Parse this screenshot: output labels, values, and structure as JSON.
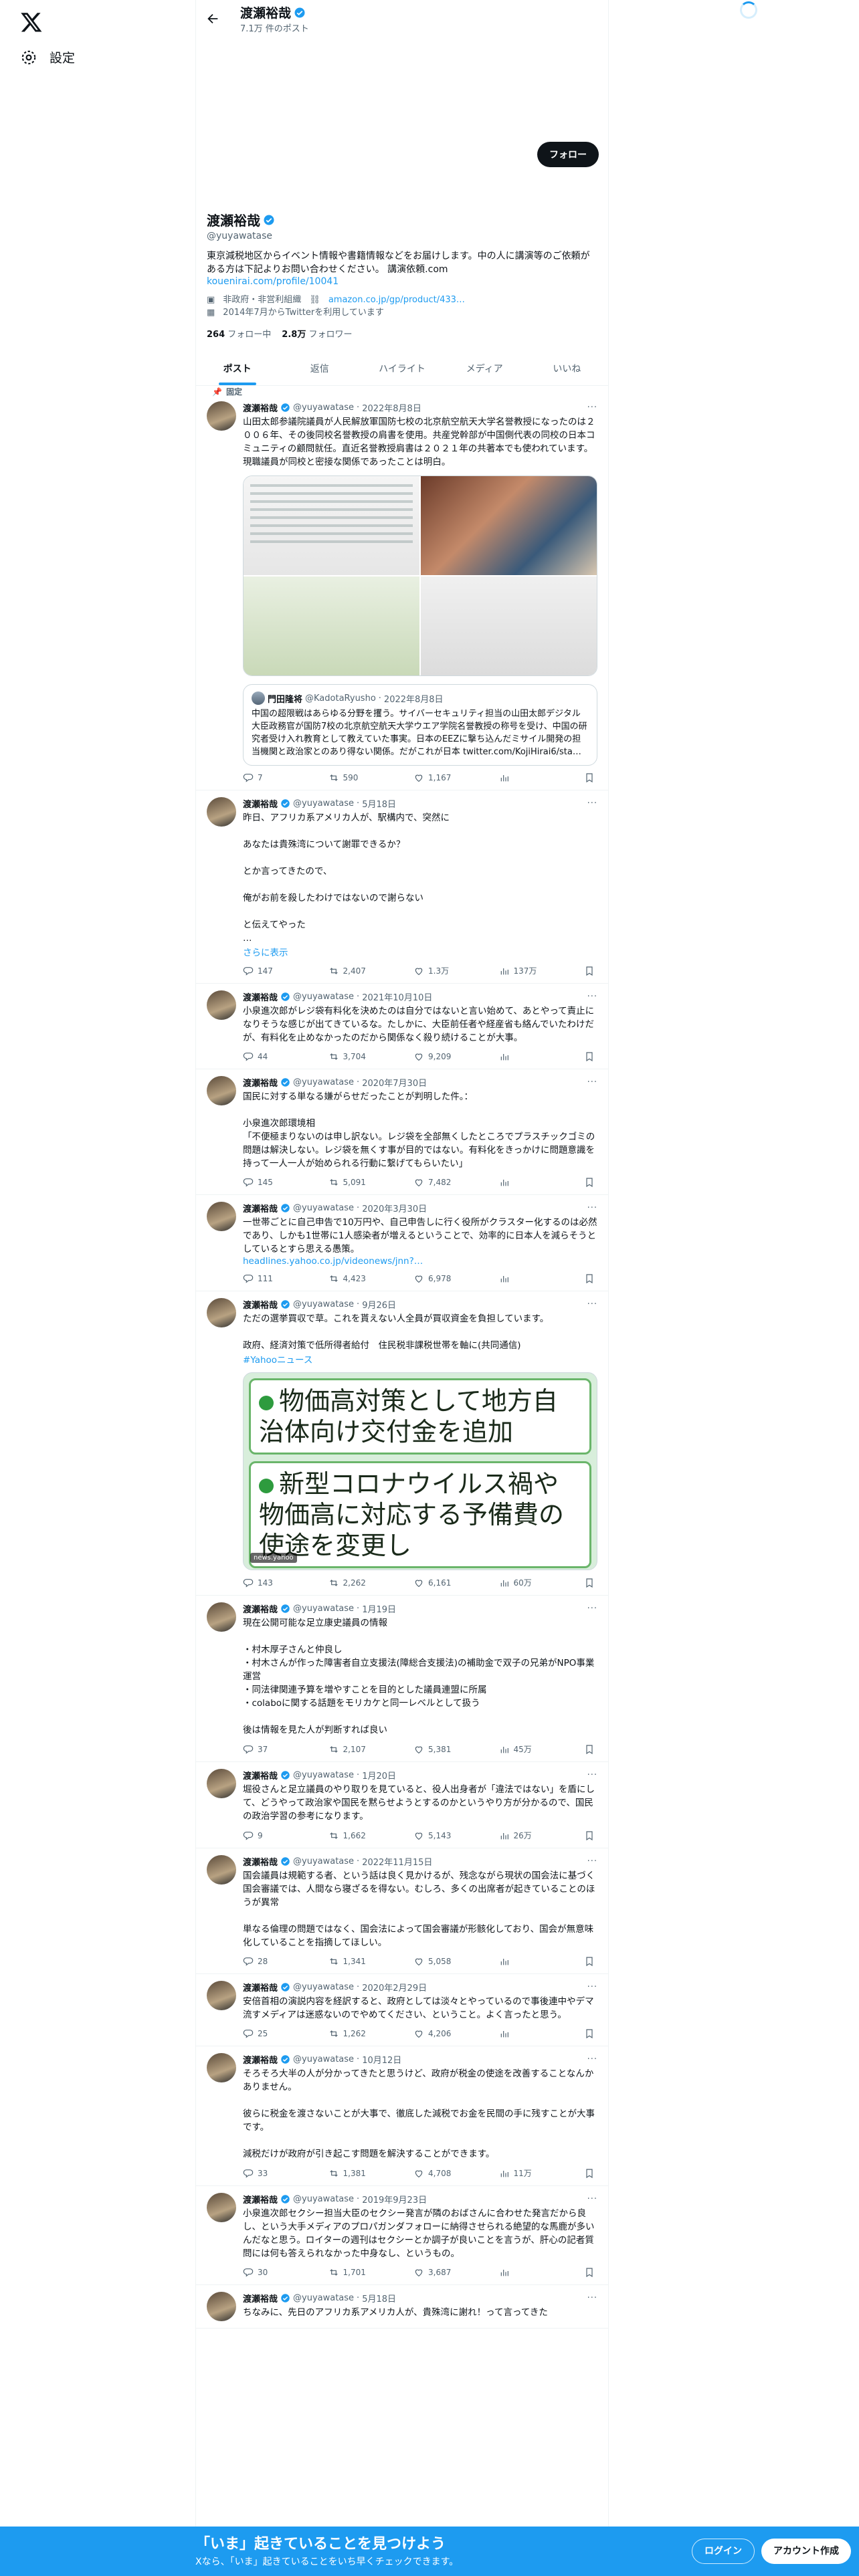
{
  "nav": {
    "settings_label": "設定"
  },
  "header": {
    "name": "渡瀬裕哉",
    "post_count": "7.1万 件のポスト"
  },
  "profile": {
    "follow_label": "フォロー",
    "name": "渡瀬裕哉",
    "handle": "@yuyawatase",
    "bio": "東京減税地区からイベント情報や書籍情報などをお届けします。中の人に講演等のご依頼がある方は下記よりお問い合わせください。 講演依頼.com",
    "bio_link": "kouenirai.com/profile/10041",
    "category": "非政府・非営利組織",
    "amazon_link": "amazon.co.jp/gp/product/433…",
    "joined": "2014年7月からTwitterを利用しています",
    "following_count": "264",
    "following_label": "フォロー中",
    "followers_count": "2.8万",
    "followers_label": "フォロワー"
  },
  "tabs": [
    "ポスト",
    "返信",
    "ハイライト",
    "メディア",
    "いいね"
  ],
  "pinned_label": "固定",
  "tweets": [
    {
      "name": "渡瀬裕哉",
      "handle": "@yuyawatase",
      "date": "2022年8月8日",
      "text": "山田太郎参議院議員が人民解放軍国防七校の北京航空航天大学名誉教授になったのは２００６年、その後同校名誉教授の肩書を使用。共産党幹部が中国側代表の同校の日本コミュニティの顧問就任。直近名誉教授肩書は２０２１年の共著本でも使われています。現職議員が同校と密接な関係であったことは明白。",
      "quote": {
        "name": "門田隆将",
        "handle": "@KadotaRyusho",
        "date": "2022年8月8日",
        "text": "中国の超限戦はあらゆる分野を攫う。サイバーセキュリティ担当の山田太郎デジタル大臣政務官が国防7校の北京航空航天大学ウエア学院名誉教授の称号を受け、中国の研究者受け入れ教育として教えていた事実。日本のEEZに撃ち込んだミサイル開発の担当機関と政治家とのあり得ない関係。だがこれが日本 twitter.com/KojiHirai6/sta…"
      },
      "replies": "7",
      "retweets": "590",
      "likes": "1,167",
      "views": ""
    },
    {
      "name": "渡瀬裕哉",
      "handle": "@yuyawatase",
      "date": "5月18日",
      "text": "昨日、アフリカ系アメリカ人が、駅構内で、突然に\n\nあなたは貴殊湾について謝罪できるか？\n\nとか言ってきたので、\n\n俺がお前を殺したわけではないので謝らない\n\nと伝えてやった\n…",
      "more_label": "さらに表示",
      "replies": "147",
      "retweets": "2,407",
      "likes": "1.3万",
      "views": "137万"
    },
    {
      "name": "渡瀬裕哉",
      "handle": "@yuyawatase",
      "date": "2021年10月10日",
      "text": "小泉進次郎がレジ袋有料化を決めたのは自分ではないと言い始めて、あとやって責止になりそうな感じが出てきているな。たしかに、大臣前任者や経産省も絡んでいたわけだが、有料化を止めなかったのだから関係なく殺り続けることが大事。",
      "replies": "44",
      "retweets": "3,704",
      "likes": "9,209",
      "views": ""
    },
    {
      "name": "渡瀬裕哉",
      "handle": "@yuyawatase",
      "date": "2020年7月30日",
      "text": "国民に対する単なる嫌がらせだったことが判明した件。：\n\n小泉進次郎環境相\n「不便極まりないのは申し訳ない。レジ袋を全部無くしたところでプラスチックゴミの問題は解決しない。レジ袋を無くす事が目的ではない。有料化をきっかけに問題意識を持って一人一人が始められる行動に繋げてもらいたい」",
      "replies": "145",
      "retweets": "5,091",
      "likes": "7,482",
      "views": ""
    },
    {
      "name": "渡瀬裕哉",
      "handle": "@yuyawatase",
      "date": "2020年3月30日",
      "text": "一世帯ごとに自己申告で10万円や、自己申告しに行く役所がクラスター化するのは必然であり、しかも1世帯に1人感染者が増えるということで、効率的に日本人を減らそうとしているとすら思える愚策。",
      "link": "headlines.yahoo.co.jp/videonews/jnn?…",
      "replies": "111",
      "retweets": "4,423",
      "likes": "6,978",
      "views": ""
    },
    {
      "name": "渡瀬裕哉",
      "handle": "@yuyawatase",
      "date": "9月26日",
      "text": "ただの選挙買収で草。これを貰えない人全員が買収資金を負担しています。\n\n政府、経済対策で低所得者給付　住民税非課税世帯を軸に(共同通信)",
      "link": "#Yahooニュース",
      "slides": [
        "物価高対策として地方自治体向け交付金を追加",
        "新型コロナウイルス禍や物価高に対応する予備費の使途を変更し"
      ],
      "credit": "news.yahoo",
      "replies": "143",
      "retweets": "2,262",
      "likes": "6,161",
      "views": "60万"
    },
    {
      "name": "渡瀬裕哉",
      "handle": "@yuyawatase",
      "date": "1月19日",
      "text": "現在公開可能な足立康史議員の情報\n\n・村木厚子さんと仲良し\n・村木さんが作った障害者自立支援法(障総合支援法)の補助金で双子の兄弟がNPO事業運営\n・同法律関連予算を増やすことを目的とした議員連盟に所属\n・colaboに関する話題をモリカケと同一レベルとして扱う\n\n後は情報を見た人が判断すれば良い",
      "replies": "37",
      "retweets": "2,107",
      "likes": "5,381",
      "views": "45万"
    },
    {
      "name": "渡瀬裕哉",
      "handle": "@yuyawatase",
      "date": "1月20日",
      "text": "堀役さんと足立議員のやり取りを見ていると、役人出身者が「違法ではない」を盾にして、どうやって政治家や国民を黙らせようとするのかというやり方が分かるので、国民の政治学習の参考になります。",
      "replies": "9",
      "retweets": "1,662",
      "likes": "5,143",
      "views": "26万"
    },
    {
      "name": "渡瀬裕哉",
      "handle": "@yuyawatase",
      "date": "2022年11月15日",
      "text": "国会議員は規範する者、という話は良く見かけるが、残念ながら現状の国会法に基づく国会審議では、人間なら寝ざるを得ない。むしろ、多くの出席者が起きていることのほうが異常\n\n単なる倫理の問題ではなく、国会法によって国会審議が形骸化しており、国会が無意味化していることを指摘してほしい。",
      "replies": "28",
      "retweets": "1,341",
      "likes": "5,058",
      "views": ""
    },
    {
      "name": "渡瀬裕哉",
      "handle": "@yuyawatase",
      "date": "2020年2月29日",
      "text": "安倍首相の演説内容を経訳すると、政府としては淡々とやっているので事後連中やデマ流すメディアは迷惑ないのでやめてください、ということ。よく言ったと思う。",
      "replies": "25",
      "retweets": "1,262",
      "likes": "4,206",
      "views": ""
    },
    {
      "name": "渡瀬裕哉",
      "handle": "@yuyawatase",
      "date": "10月12日",
      "text": "そろそろ大半の人が分かってきたと思うけど、政府が税金の使途を改善することなんかありません。\n\n彼らに税金を渡さないことが大事で、徹底した減税でお金を民間の手に残すことが大事です。\n\n減税だけが政府が引き起こす問題を解決することができます。",
      "replies": "33",
      "retweets": "1,381",
      "likes": "4,708",
      "views": "11万"
    },
    {
      "name": "渡瀬裕哉",
      "handle": "@yuyawatase",
      "date": "2019年9月23日",
      "text": "小泉進次郎セクシー担当大臣のセクシー発言が隣のおばさんに合わせた発言だから良し、という大手メディアのプロパガンダフォローに納得させられる絶望的な馬鹿が多いんだなと思う。ロイターの週刊はセクシーとか調子が良いことを言うが、肝心の記者質問には何も答えられなかった中身なし、というもの。",
      "replies": "30",
      "retweets": "1,701",
      "likes": "3,687",
      "views": ""
    },
    {
      "name": "渡瀬裕哉",
      "handle": "@yuyawatase",
      "date": "5月18日",
      "text": "ちなみに、先日のアフリカ系アメリカ人が、貴殊湾に謝れ！って言ってきた",
      "replies": "",
      "retweets": "",
      "likes": "",
      "views": ""
    }
  ],
  "bottom_bar": {
    "title": "「いま」起きていることを見つけよう",
    "subtitle": "Xなら、「いま」起きていることをいち早くチェックできます。",
    "login_label": "ログイン",
    "signup_label": "アカウント作成"
  }
}
